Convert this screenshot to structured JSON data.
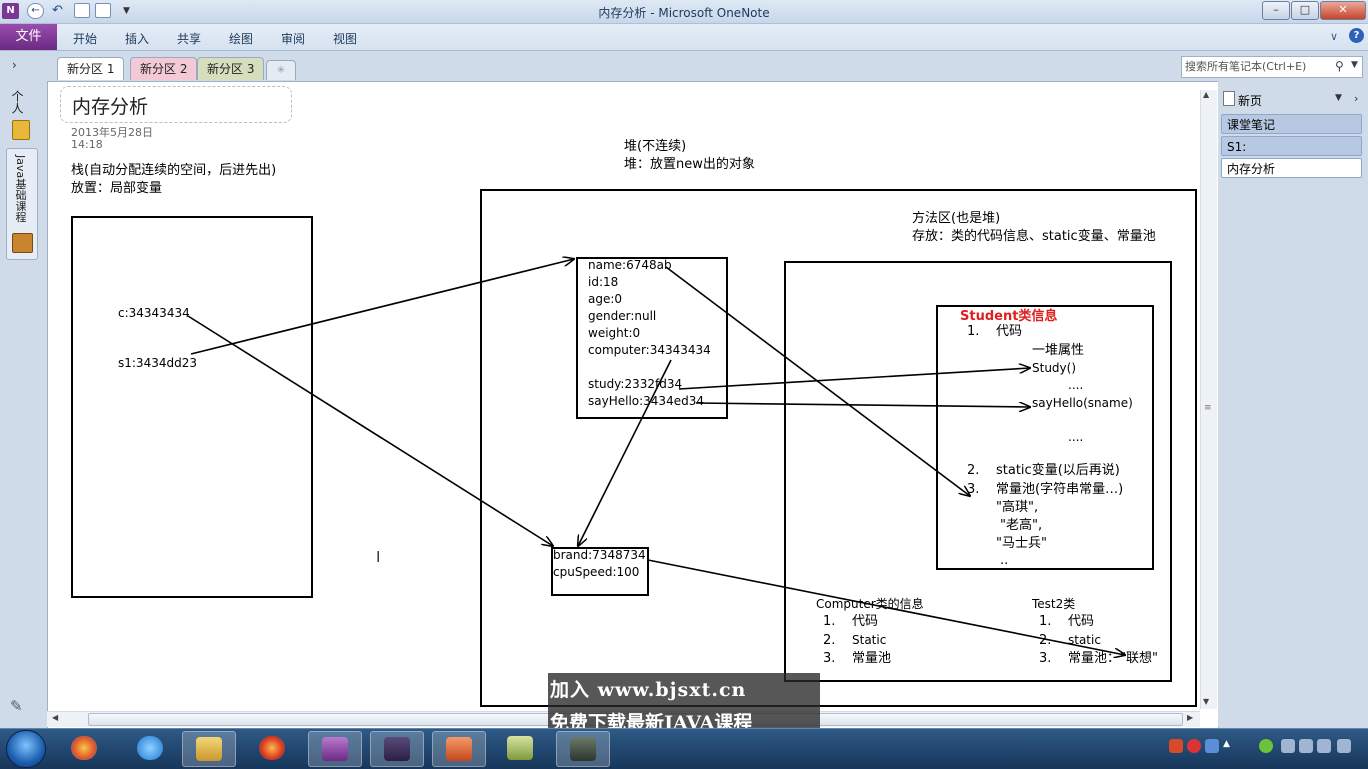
{
  "window": {
    "title": "内存分析 - Microsoft OneNote",
    "logo": "N"
  },
  "ribbon": {
    "file": "文件",
    "tabs": [
      "开始",
      "插入",
      "共享",
      "绘图",
      "审阅",
      "视图"
    ],
    "help": "?"
  },
  "sections": {
    "tabs": [
      "新分区 1",
      "新分区 2",
      "新分区 3"
    ],
    "colors": [
      "#ffffff",
      "#f3c9d6",
      "#d5dfbd"
    ]
  },
  "search": {
    "placeholder": "搜索所有笔记本(Ctrl+E)"
  },
  "notebooks": {
    "personal": "个人",
    "java": "Java基础课程"
  },
  "page": {
    "title": "内存分析",
    "date": "2013年5月28日",
    "time": "14:18",
    "stack_note": [
      "栈(自动分配连续的空间，后进先出)",
      "放置：局部变量"
    ],
    "heap_note": [
      "堆(不连续)",
      "堆：放置new出的对象"
    ],
    "method_note": [
      "方法区(也是堆)",
      "存放：类的代码信息、static变量、常量池"
    ],
    "stack_vars": [
      "c:34343434",
      "s1:3434dd23"
    ],
    "student_obj": [
      "name:6748ab",
      "id:18",
      "age:0",
      "gender:null",
      "weight:0",
      "computer:34343434",
      "",
      "study:2332fd34",
      "sayHello:3434ed34"
    ],
    "computer_obj": [
      "brand:7348734",
      "cpuSpeed:100"
    ],
    "student_class": {
      "title": "Student类信息",
      "n1": "1.",
      "code": "代码",
      "attrs": "一堆属性",
      "study": "Study()",
      "dots1": "....",
      "sayhello": "sayHello(sname)",
      "dots2": "....",
      "n2": "2.",
      "static": "static变量(以后再说)",
      "n3": "3.",
      "pool": "常量池(字符串常量…)",
      "s1": "\"高琪\",",
      "s2": "\"老高\",",
      "s3": "\"马士兵\"",
      "s4": ".."
    },
    "computer_class": {
      "title": "Computer类的信息",
      "n1": "1.",
      "i1": "代码",
      "n2": "2.",
      "i2": "Static",
      "n3": "3.",
      "i3": "常量池"
    },
    "test2_class": {
      "title": "Test2类",
      "n1": "1.",
      "i1": "代码",
      "n2": "2.",
      "i2": "static",
      "n3": "3.",
      "i3": "常量池：\"联想\""
    }
  },
  "page_list": {
    "new_page": "新页",
    "pages": [
      "课堂笔记",
      "S1:",
      "内存分析"
    ]
  },
  "watermark": [
    "加入 www.bjsxt.cn",
    "免费下载最新JAVA课程"
  ],
  "taskbar": {
    "apps": [
      "start-orb",
      "app-icon",
      "ie-icon",
      "explorer-icon",
      "firefox-icon",
      "onenote-icon",
      "javaee-ide-icon",
      "powerpoint-icon",
      "app-icon-2",
      "recorder-icon"
    ],
    "accent": "#17365a"
  }
}
